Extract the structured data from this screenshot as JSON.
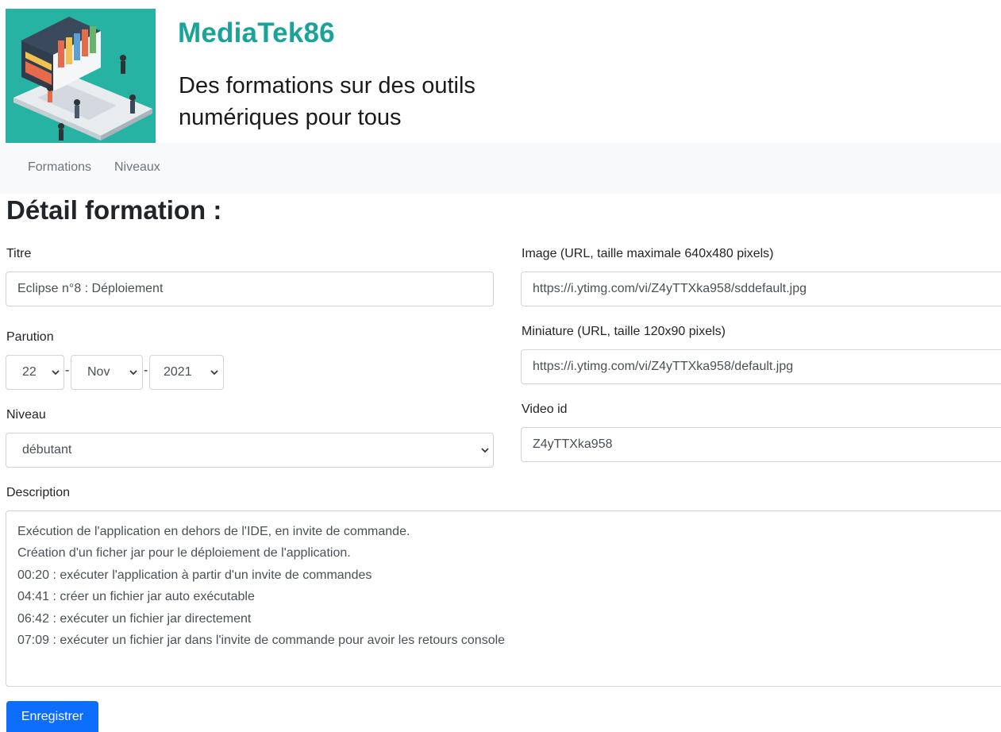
{
  "header": {
    "brand": "MediaTek86",
    "tagline_line1": "Des formations sur des outils",
    "tagline_line2": "numériques pour tous",
    "logo_icon": "library-laptop-illustration"
  },
  "nav": {
    "items": [
      {
        "label": "Formations"
      },
      {
        "label": "Niveaux"
      }
    ]
  },
  "page": {
    "title": "Détail formation :"
  },
  "form": {
    "titre": {
      "label": "Titre",
      "value": "Eclipse n°8 : Déploiement"
    },
    "parution": {
      "label": "Parution",
      "day": "22",
      "month": "Nov",
      "year": "2021",
      "separator": "-"
    },
    "niveau": {
      "label": "Niveau",
      "value": "débutant"
    },
    "image": {
      "label": "Image (URL, taille maximale 640x480 pixels)",
      "value": "https://i.ytimg.com/vi/Z4yTTXka958/sddefault.jpg"
    },
    "miniature": {
      "label": "Miniature (URL, taille 120x90 pixels)",
      "value": "https://i.ytimg.com/vi/Z4yTTXka958/default.jpg"
    },
    "video_id": {
      "label": "Video id",
      "value": "Z4yTTXka958"
    },
    "description": {
      "label": "Description",
      "lines": [
        "Exécution de l'application en dehors de l'IDE, en invite de commande.",
        "Création d'un ficher jar pour le déploiement de l'application.",
        "00:20 : exécuter l'application à partir d'un invite de commandes",
        "04:41 : créer un fichier jar auto exécutable",
        "06:42 : exécuter un fichier jar directement",
        "07:09 : exécuter un fichier jar dans l'invite de commande pour avoir les retours console"
      ]
    },
    "submit_label": "Enregistrer"
  },
  "colors": {
    "brand": "#1aa39a",
    "primary_button": "#0d6efd",
    "navbar_bg": "#f8f9fa",
    "logo_bg": "#26b3a4"
  }
}
